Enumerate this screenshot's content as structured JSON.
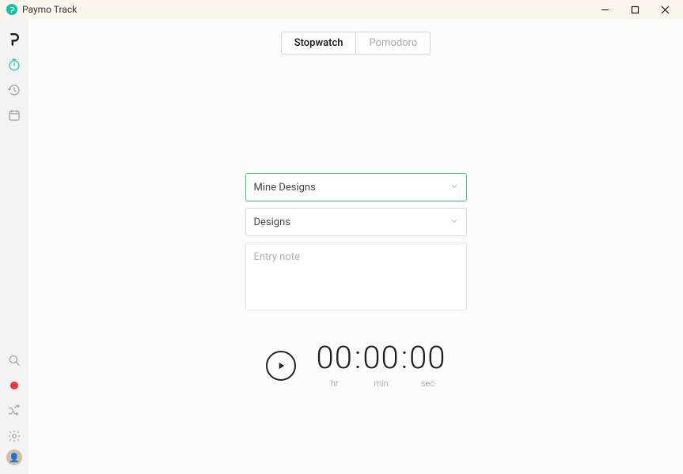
{
  "titlebar": {
    "title": "Paymo Track"
  },
  "tabs": {
    "stopwatch": "Stopwatch",
    "pomodoro": "Pomodoro"
  },
  "project_select": {
    "value": "Mine Designs"
  },
  "task_select": {
    "value": "Designs"
  },
  "note": {
    "placeholder": "Entry note",
    "value": ""
  },
  "timer": {
    "hr": "00",
    "min": "00",
    "sec": "00",
    "hr_label": "hr",
    "min_label": "min",
    "sec_label": "sec"
  }
}
